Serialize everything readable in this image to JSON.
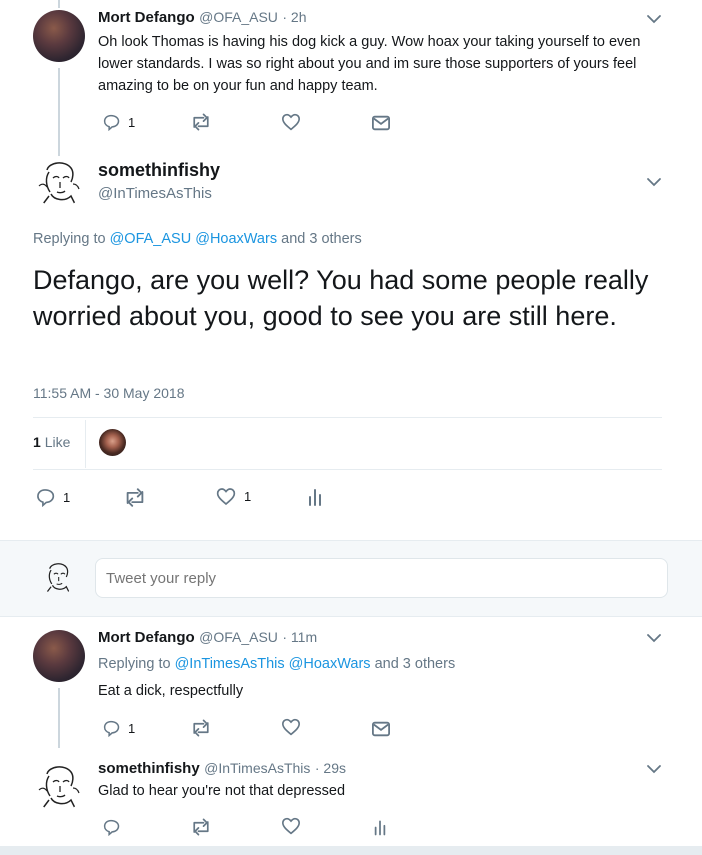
{
  "tweet1": {
    "name": "Mort Defango",
    "handle": "@OFA_ASU",
    "time": "· 2h",
    "text": "Oh look Thomas is having his dog kick a guy. Wow hoax your taking yourself to even lower standards. I was so right about you and im sure those supporters of yours feel amazing to be on your fun and happy team.",
    "reply_count": "1",
    "retweet_count": "",
    "like_count": ""
  },
  "main": {
    "name": "somethinfishy",
    "handle": "@InTimesAsThis",
    "replying_prefix": "Replying to",
    "replying_to": [
      "@OFA_ASU",
      "@HoaxWars"
    ],
    "replying_suffix": "and 3 others",
    "text": "Defango, are you well? You had some people really worried about you, good to see you are still here.",
    "timestamp": "11:55 AM - 30 May 2018",
    "likes_count": "1",
    "likes_label": "Like",
    "reply_count": "1",
    "like_count": "1"
  },
  "composer": {
    "placeholder": "Tweet your reply"
  },
  "reply1": {
    "name": "Mort Defango",
    "handle": "@OFA_ASU",
    "time": "· 11m",
    "replying_prefix": "Replying to",
    "replying_to": [
      "@InTimesAsThis",
      "@HoaxWars"
    ],
    "replying_suffix": "and 3 others",
    "text": "Eat a dick, respectfully",
    "reply_count": "1"
  },
  "reply2": {
    "name": "somethinfishy",
    "handle": "@InTimesAsThis",
    "time": "· 29s",
    "text": "Glad to hear you're not that depressed"
  },
  "colors": {
    "link": "#1b95e0",
    "muted": "#657786",
    "divider": "#e6ecf0",
    "composer_bg": "#f5f8fa"
  }
}
